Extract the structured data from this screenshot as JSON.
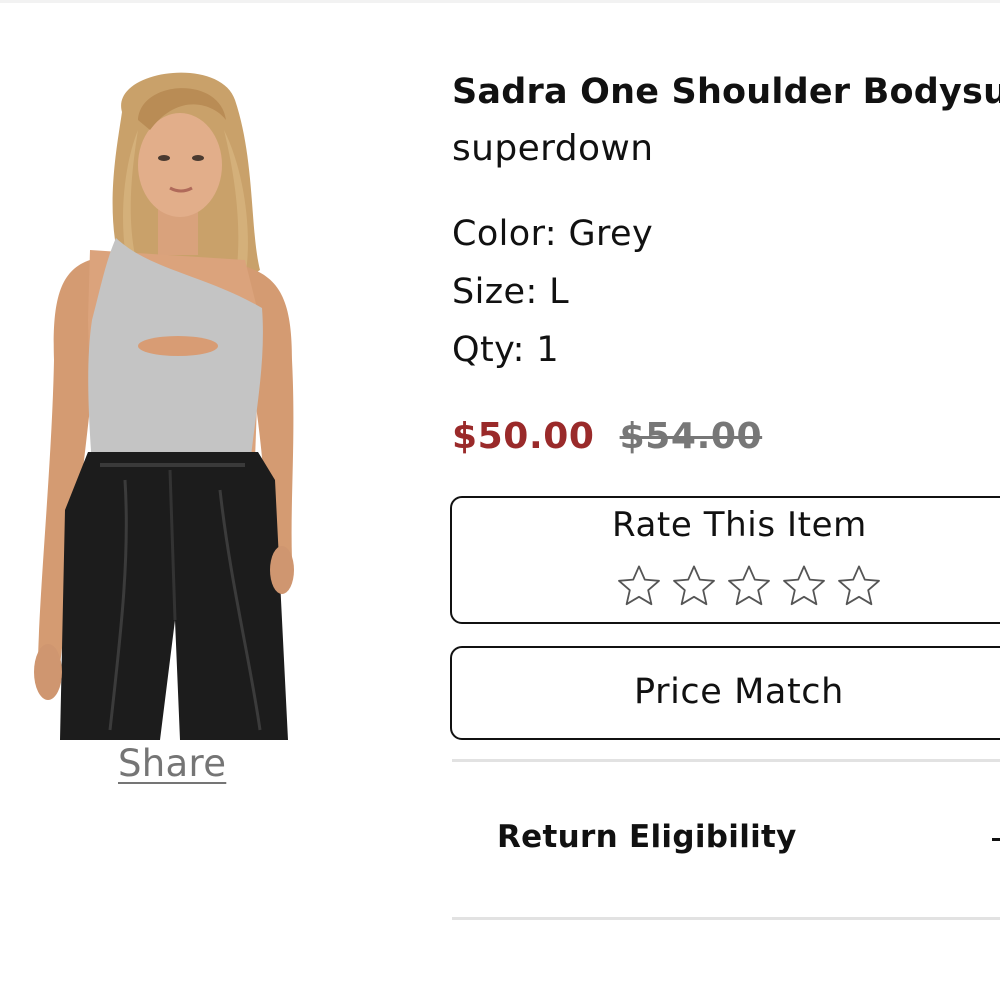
{
  "product": {
    "title": "Sadra One Shoulder Bodysu",
    "brand": "superdown",
    "image": {
      "icon": "product-photo-grey-one-shoulder-bodysuit"
    },
    "share_label": "Share"
  },
  "attributes": {
    "color": "Color: Grey",
    "size": "Size: L",
    "qty": "Qty: 1"
  },
  "pricing": {
    "sale_price": "$50.00",
    "original_price": "$54.00",
    "sale_color": "#9a2a2a",
    "original_color": "#777777"
  },
  "rating": {
    "label": "Rate This Item",
    "stars_filled": 0,
    "stars_total": 5,
    "star_icon": "star-outline-icon"
  },
  "price_match": {
    "label": "Price Match"
  },
  "return_section": {
    "label": "Return Eligibility",
    "expand_icon": "plus-icon"
  }
}
